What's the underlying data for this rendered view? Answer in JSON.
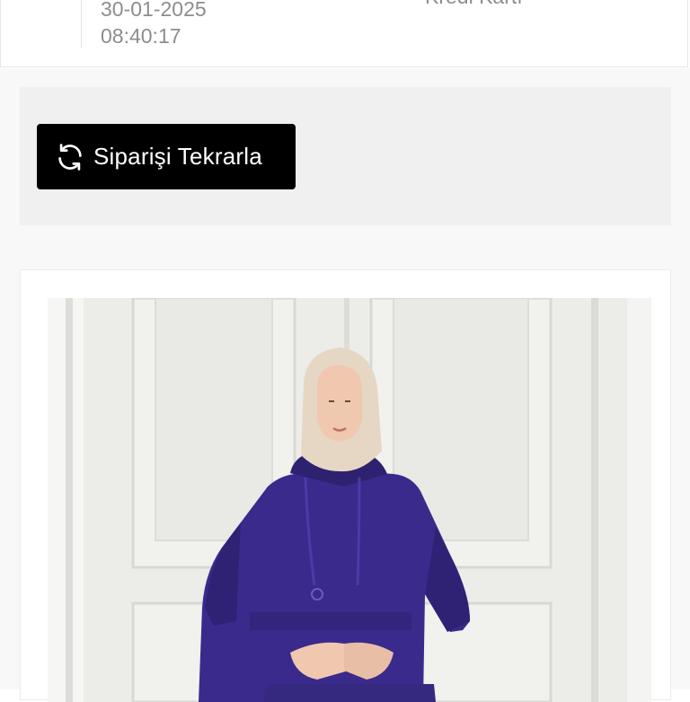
{
  "order": {
    "date": "30-01-2025",
    "time": "08:40:17",
    "payment_method": "Kredi Kartı"
  },
  "actions": {
    "reorder_label": "Siparişi Tekrarla",
    "reorder_icon": "refresh-icon"
  },
  "product": {
    "image_icon": "product-photo",
    "colors": {
      "garment": "#3a2a8c",
      "hijab": "#e6d6c4",
      "background": "#ededea"
    }
  }
}
